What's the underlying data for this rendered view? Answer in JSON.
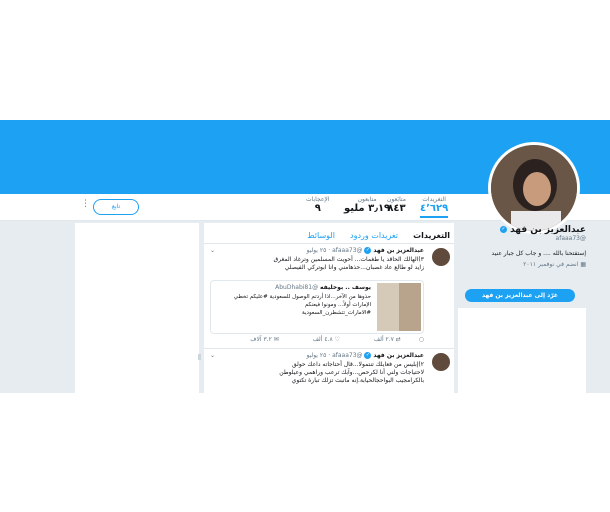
{
  "profile": {
    "name": "عبدالعزيز بن فهد",
    "handle": "@afaaa73",
    "bio": "إستفتحنا بالله .... و جاب كل جبار عنيد",
    "joined": "انضم في نوفمبر ٢٠١١",
    "tweet_to_label": "غرّد إلى عبدالعزيز بن فهد"
  },
  "stats": [
    {
      "label": "التغريدات",
      "value": "٤٬٦٢٩"
    },
    {
      "label": "متابَعون",
      "value": "٨٤٣"
    },
    {
      "label": "متابعون",
      "value": "٣٫١٩ مليو"
    },
    {
      "label": "الإعجابات",
      "value": "٩"
    }
  ],
  "follow_label": "تابع",
  "more_icon": "vertical-dots-icon",
  "timeline": {
    "tabs": [
      "التغريدات",
      "تغريدات وردود",
      "الوسائط"
    ],
    "tweets": [
      {
        "name": "عبدالعزيز بن فهد",
        "handle": "@afaaa73",
        "date": "٢٥ يوليو",
        "lines": [
          "٣)الهالك الحاقد يا طغمات... أحويت المسلمين وترغاد المغرق",
          "زايد لو طالع عاد غصبان...حذهامني وانا ابوتركي الفيصلي"
        ],
        "quote": {
          "name": "يوسف .. بوخليفه",
          "handle": "@AbuDhabi81",
          "lines": [
            "حذوها من الآخر...اذا أردتم الوصول للسعودية #عليكم تخطي",
            "الإمارات أولاً... ومونوا فيعنكم",
            "#الامارات_تتشطرن_السعودية"
          ]
        },
        "actions": {
          "reply": "",
          "retweet": "٢.٧ ألف",
          "like": "٤.٨ ألف",
          "mail": "٣.٢ آلاف"
        }
      },
      {
        "name": "عبدالعزيز بن فهد",
        "handle": "@afaaa73",
        "date": "٢٥ يوليو",
        "lines": [
          "٢)إبليس من فعايلك تنتمولا...قال أحتاجاته داعك حولق",
          "لاحتياجات ولني أنا لكرحص...وآبك ترعب وراهمي وعيلوطن",
          "بالكرامجيب البواحجالحيابة.إنه ماتبت تزلك تبارة تكتوي"
        ]
      }
    ]
  },
  "colors": {
    "accent": "#1da1f2",
    "background": "#e6ecf0"
  }
}
